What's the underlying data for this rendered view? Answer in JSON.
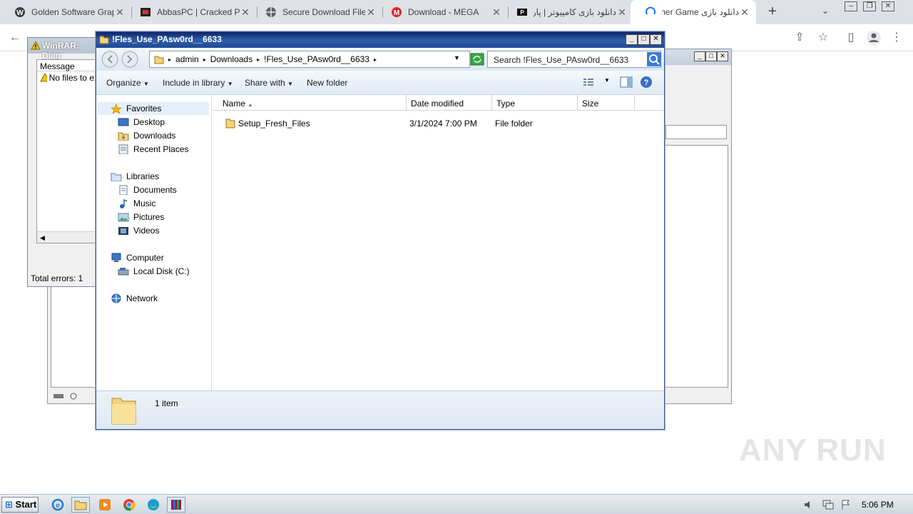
{
  "browser": {
    "tabs": [
      {
        "title": "Golden Software Graph",
        "icon": "wordpress-icon"
      },
      {
        "title": "AbbasPC | Cracked PC",
        "icon": "abbaspc-icon"
      },
      {
        "title": "Secure Download File",
        "icon": "globe-icon"
      },
      {
        "title": "Download - MEGA",
        "icon": "mega-icon"
      },
      {
        "title": "دانلود بازی کامپیوتر | پار",
        "icon": "site-icon"
      },
      {
        "title": "دانلود بازی Runner Game",
        "icon": "loading-icon"
      }
    ],
    "new_tab": "+"
  },
  "winrar": {
    "title": "WinRAR: Diag",
    "col_message": "Message",
    "message": "No files to ex",
    "total_errors": "Total errors: 1"
  },
  "explorer": {
    "title": "!Fles_Use_PAsw0rd__6633",
    "breadcrumb": [
      "admin",
      "Downloads",
      "!Fles_Use_PAsw0rd__6633"
    ],
    "search_placeholder": "Search !Fles_Use_PAsw0rd__6633",
    "commands": {
      "organize": "Organize",
      "include": "Include in library",
      "share": "Share with",
      "new_folder": "New folder"
    },
    "nav": {
      "favorites": "Favorites",
      "desktop": "Desktop",
      "downloads": "Downloads",
      "recent": "Recent Places",
      "libraries": "Libraries",
      "documents": "Documents",
      "music": "Music",
      "pictures": "Pictures",
      "videos": "Videos",
      "computer": "Computer",
      "local_disk": "Local Disk (C:)",
      "network": "Network"
    },
    "columns": {
      "name": "Name",
      "date": "Date modified",
      "type": "Type",
      "size": "Size"
    },
    "files": [
      {
        "name": "Setup_Fresh_Files",
        "date": "3/1/2024 7:00 PM",
        "type": "File folder",
        "size": ""
      }
    ],
    "status": "1 item"
  },
  "taskbar": {
    "start": "Start",
    "time": "5:06 PM"
  },
  "watermark": "ANY RUN"
}
